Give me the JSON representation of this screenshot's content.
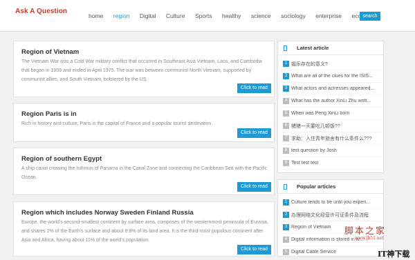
{
  "header": {
    "brand": "Ask A Question",
    "nav": [
      "home",
      "region",
      "Digital",
      "Culture",
      "Sports",
      "healthy",
      "science",
      "sociology",
      "enterprise",
      "economics"
    ],
    "search_label": "search"
  },
  "articles": [
    {
      "title": "Region of Vietnam",
      "body": "The Vietnam War was a Cold War military conflict that occurred in Southeast Asia Vietnam, Laos, and Cambodia that began in 1959 and ended in April 1975. The war was between communist North Vietnam, supported by communist allies, and South Vietnam, bolstered by the US.",
      "button": "Click to read"
    },
    {
      "title": "Region Paris is in",
      "body": "Rich in history and culture, Paris is the capital of France and a popular tourist destination.",
      "button": "Click to read"
    },
    {
      "title": "Region of southern Egypt",
      "body": "A ship canal crossing the Isthmus of Panama in the Canal Zone and connecting the Caribbean Sea with the Pacific Ocean.",
      "button": "Click to read"
    },
    {
      "title": "Region which includes Norway Sweden Finland Russia",
      "body": "Europe, the world's second-smallest continent by surface area, comprises of the westernmost peninsula of Eurasia, and shares 2% of the Earth's surface and about 6.8% of its land area. It is the third-most populous continent after Asia and Africa, having about 11% of the world's population.",
      "button": "Click to read"
    }
  ],
  "latest": {
    "title": "Latest article",
    "items": [
      {
        "n": "1",
        "text": "锻乐存在的意义?"
      },
      {
        "n": "2",
        "text": "What are all of the clues for the ISIS..."
      },
      {
        "n": "3",
        "text": "What actors and actresses appeared..."
      },
      {
        "n": "4",
        "text": "What has the author XinLi Zhu writt..."
      },
      {
        "n": "5",
        "text": "When was Peng XinLi born"
      },
      {
        "n": "6",
        "text": "猪猪一天要吃几顿饭??"
      },
      {
        "n": "7",
        "text": "求助：入住青年旅舍有什么条件么???"
      },
      {
        "n": "8",
        "text": "test question by Josh"
      },
      {
        "n": "9",
        "text": "Test test test"
      }
    ]
  },
  "popular": {
    "title": "Popular articles",
    "items": [
      {
        "n": "1",
        "text": "Culture tends to be until you experi..."
      },
      {
        "n": "2",
        "text": "办理网络文化经营许可证条件及流程"
      },
      {
        "n": "3",
        "text": "Region of Vietnam"
      },
      {
        "n": "4",
        "text": "Digital information is stored in w..."
      },
      {
        "n": "5",
        "text": "Digital Cable Service"
      }
    ]
  },
  "watermark": {
    "cn": "脚本之家",
    "url": "www.jb51.net",
    "corner": "IT神下载网"
  },
  "colors": {
    "accent": "#1b9ad6",
    "brand": "#c0392b"
  }
}
